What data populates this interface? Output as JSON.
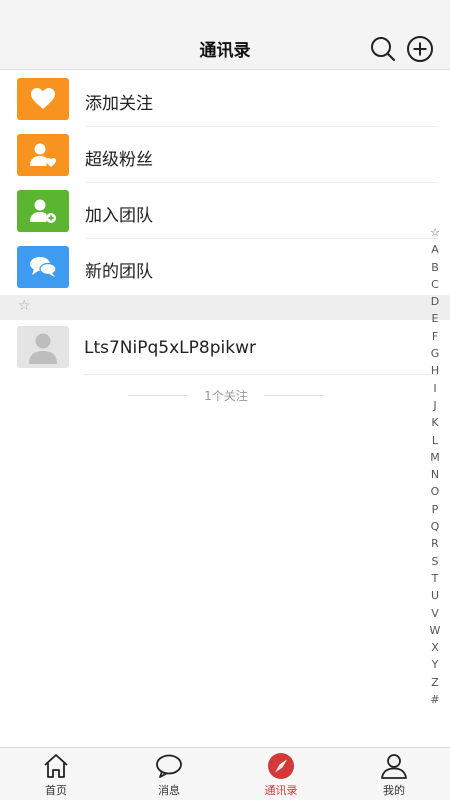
{
  "header": {
    "title": "通讯录",
    "search_icon": "search-icon",
    "add_icon": "plus-circle-icon"
  },
  "menu": [
    {
      "label": "添加关注",
      "icon": "heart-icon",
      "color": "#f7931e"
    },
    {
      "label": "超级粉丝",
      "icon": "user-heart-icon",
      "color": "#f7931e"
    },
    {
      "label": "加入团队",
      "icon": "user-add-icon",
      "color": "#5cb531"
    },
    {
      "label": "新的团队",
      "icon": "chat-bubbles-icon",
      "color": "#3e9bf0"
    }
  ],
  "section": {
    "star": "☆"
  },
  "contacts": [
    {
      "name": "Lts7NiPq5xLP8pikwr",
      "avatar": "default-avatar-icon"
    }
  ],
  "count_text": "1个关注",
  "index_letters": [
    "☆",
    "A",
    "B",
    "C",
    "D",
    "E",
    "F",
    "G",
    "H",
    "I",
    "J",
    "K",
    "L",
    "M",
    "N",
    "O",
    "P",
    "Q",
    "R",
    "S",
    "T",
    "U",
    "V",
    "W",
    "X",
    "Y",
    "Z",
    "#"
  ],
  "tabs": [
    {
      "label": "首页",
      "icon": "home-icon",
      "active": false
    },
    {
      "label": "消息",
      "icon": "message-icon",
      "active": false
    },
    {
      "label": "通讯录",
      "icon": "compass-icon",
      "active": true
    },
    {
      "label": "我的",
      "icon": "person-icon",
      "active": false
    }
  ],
  "colors": {
    "accent": "#d23a3a",
    "orange": "#f7931e",
    "green": "#5cb531",
    "blue": "#3e9bf0"
  }
}
